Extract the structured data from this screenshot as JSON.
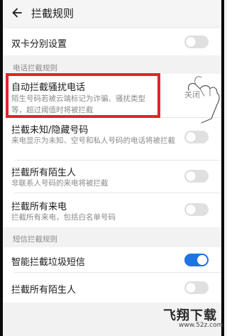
{
  "header": {
    "title": "拦截规则"
  },
  "rows": {
    "dual_sim": {
      "title": "双卡分别设置",
      "enabled": false
    },
    "auto_block": {
      "title": "自动拦截骚扰电话",
      "desc": "陌生号码若被云端标记为诈骗、骚扰类型等，超过阈值时将被拦截",
      "value": "关闭"
    },
    "unknown_hidden": {
      "title": "拦截未知/隐藏号码",
      "desc": "来电显示为未知、空号和私人号码的电话将被拦截",
      "enabled": false
    },
    "strangers_calls": {
      "title": "拦截所有陌生人",
      "desc": "非联系人号码的来电将被拦截",
      "enabled": false
    },
    "all_calls": {
      "title": "拦截所有来电",
      "desc": "拦截所有来电，包括白名单号码",
      "enabled": false
    },
    "smart_spam_sms": {
      "title": "智能拦截垃圾短信",
      "enabled": true
    },
    "strangers_sms": {
      "title": "拦截所有陌生人",
      "enabled": false
    }
  },
  "sections": {
    "call_rules": "电话拦截规则",
    "sms_rules": "短信拦截规则"
  },
  "watermark": {
    "main": "飞翔下载",
    "url": "www.52z.com"
  },
  "colors": {
    "accent": "#1e73e6",
    "highlight": "#e02525"
  }
}
